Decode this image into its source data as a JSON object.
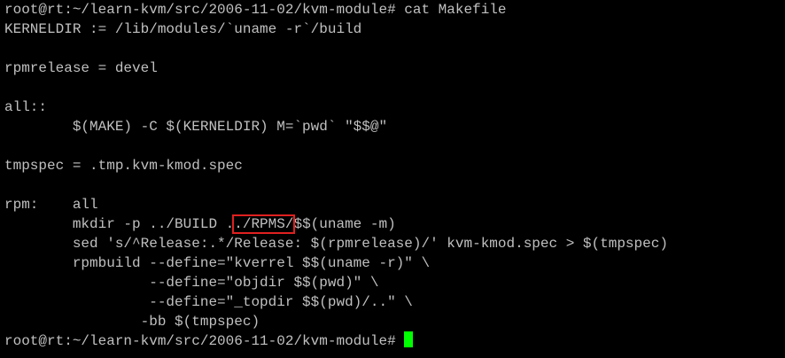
{
  "colors": {
    "background": "#000000",
    "text": "#c0c0c0",
    "cursor": "#00ff00",
    "highlight_box": "#e02020"
  },
  "terminal": {
    "lines": [
      "root@rt:~/learn-kvm/src/2006-11-02/kvm-module# cat Makefile",
      "KERNELDIR := /lib/modules/`uname -r`/build",
      "",
      "rpmrelease = devel",
      "",
      "all::",
      "        $(MAKE) -C $(KERNELDIR) M=`pwd` \"$$@\"",
      "",
      "tmpspec = .tmp.kvm-kmod.spec",
      "",
      "rpm:    all",
      null,
      "        sed 's/^Release:.*/Release: $(rpmrelease)/' kvm-kmod.spec > $(tmpspec)",
      "        rpmbuild --define=\"kverrel $$(uname -r)\" \\",
      "                 --define=\"objdir $$(pwd)\" \\",
      "                 --define=\"_topdir $$(pwd)/..\" \\",
      "                -bb $(tmpspec)",
      null
    ],
    "mkdir_line": {
      "before": "        mkdir -p ../BUILD .",
      "highlighted": "./RPMS/",
      "after": "$$(uname -m)"
    },
    "prompt": "root@rt:~/learn-kvm/src/2006-11-02/kvm-module# "
  }
}
